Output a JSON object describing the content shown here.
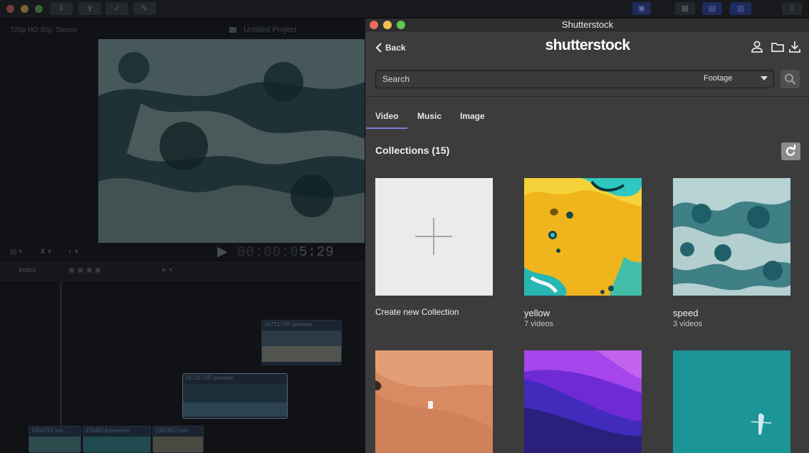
{
  "background_editor": {
    "format_label": "720p HD 30p, Stereo",
    "project_name": "Untitled Project",
    "timecode_dim": "00:00:0",
    "timecode": "5:29",
    "index_label": "Index",
    "clips": [
      {
        "name": "167217XP preview"
      },
      {
        "name": "167217XP preview"
      },
      {
        "name": "1604701 pre..."
      },
      {
        "name": "2284918-preview"
      },
      {
        "name": "2361852-pre..."
      }
    ]
  },
  "window": {
    "title": "Shutterstock"
  },
  "header": {
    "back_label": "Back",
    "logo": "shutterstock",
    "icons": [
      "account-icon",
      "folder-icon",
      "download-icon"
    ]
  },
  "search": {
    "placeholder": "Search",
    "value": "",
    "type_selected": "Footage"
  },
  "tabs": [
    {
      "label": "Video",
      "active": true
    },
    {
      "label": "Music",
      "active": false
    },
    {
      "label": "Image",
      "active": false
    }
  ],
  "collections": {
    "title": "Collections (15)",
    "create_label": "Create new Collection",
    "items": [
      {
        "name": "yellow",
        "count": "7 videos"
      },
      {
        "name": "speed",
        "count": "3 videos"
      }
    ]
  },
  "colors": {
    "accent_tab": "#7b7fe0",
    "panel_bg": "#3c3c3c",
    "close": "#ed6a5e",
    "minimize": "#f5bf4f",
    "zoom": "#61c554"
  }
}
